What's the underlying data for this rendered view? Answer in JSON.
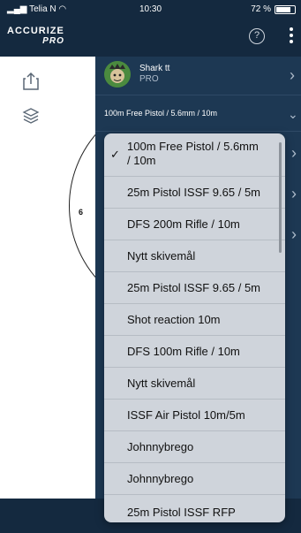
{
  "status_bar": {
    "carrier": "Telia N",
    "time": "10:30",
    "battery": "72 %"
  },
  "header": {
    "logo_top": "ACCURIZE",
    "logo_bottom": "PRO"
  },
  "profile": {
    "name": "Shark tt",
    "subtitle": "PRO"
  },
  "current_selection": "100m Free Pistol / 5.6mm / 10m",
  "target": {
    "ring_label": "6"
  },
  "dropdown": {
    "items": [
      "100m Free Pistol / 5.6mm / 10m",
      "25m Pistol ISSF 9.65 / 5m",
      "DFS 200m Rifle / 10m",
      "Nytt skivemål",
      "25m Pistol ISSF 9.65 / 5m",
      "Shot reaction 10m",
      "DFS 100m Rifle / 10m",
      "Nytt skivemål",
      "ISSF Air Pistol 10m/5m",
      "Johnnybrego",
      "Johnnybrego",
      "25m Pistol ISSF RFP"
    ],
    "selected_index": 0
  },
  "icons": [
    "signal-icon",
    "wifi-icon",
    "battery-icon",
    "help-icon",
    "more-icon",
    "share-icon",
    "layers-icon",
    "checkmark-icon",
    "chevron-right-icon",
    "chevron-down-icon"
  ]
}
